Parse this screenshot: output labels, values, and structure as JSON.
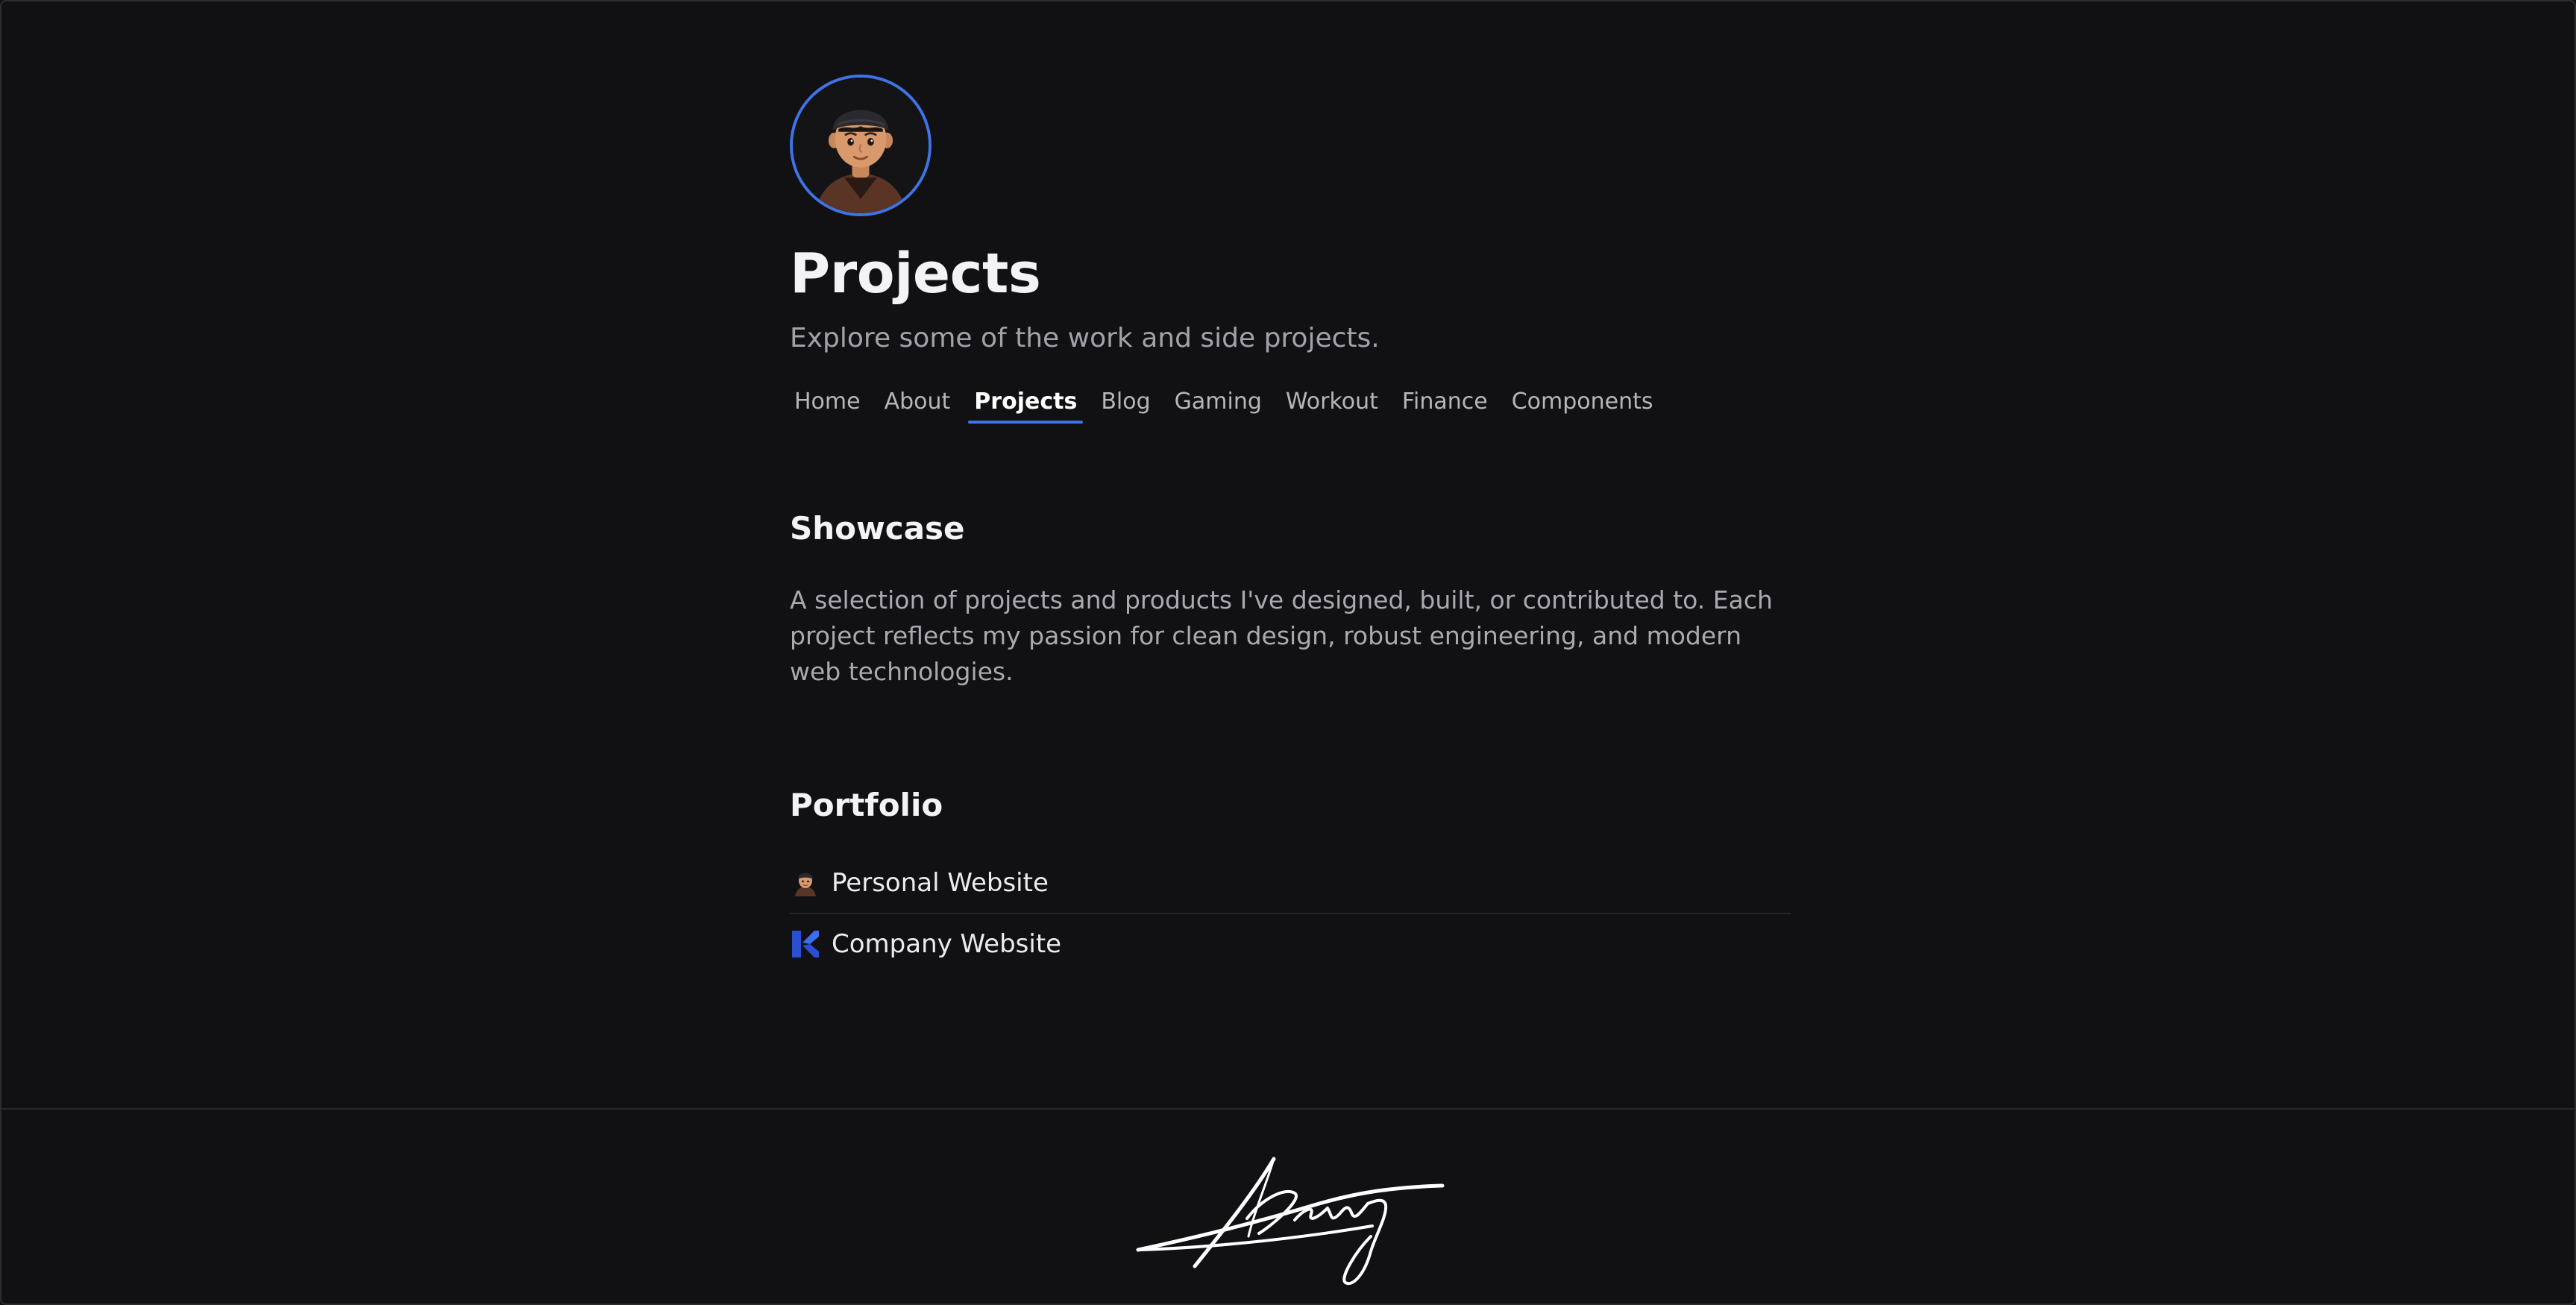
{
  "header": {
    "title": "Projects",
    "subtitle": "Explore some of the work and side projects."
  },
  "nav": {
    "items": [
      {
        "label": "Home"
      },
      {
        "label": "About"
      },
      {
        "label": "Projects",
        "active": true
      },
      {
        "label": "Blog"
      },
      {
        "label": "Gaming"
      },
      {
        "label": "Workout"
      },
      {
        "label": "Finance"
      },
      {
        "label": "Components"
      }
    ]
  },
  "showcase": {
    "title": "Showcase",
    "text": "A selection of projects and products I've designed, built, or contributed to. Each project reflects my passion for clean design, robust engineering, and modern web technologies."
  },
  "portfolio": {
    "title": "Portfolio",
    "items": [
      {
        "label": "Personal Website",
        "icon": "person-emoji-icon"
      },
      {
        "label": "Company Website",
        "icon": "company-k-logo-icon"
      }
    ]
  },
  "footer": {
    "signature": "Kenny"
  },
  "colors": {
    "background": "#111114",
    "accent": "#3f74e6",
    "text": "#f3f3f5",
    "muted": "#a2a2aa"
  }
}
